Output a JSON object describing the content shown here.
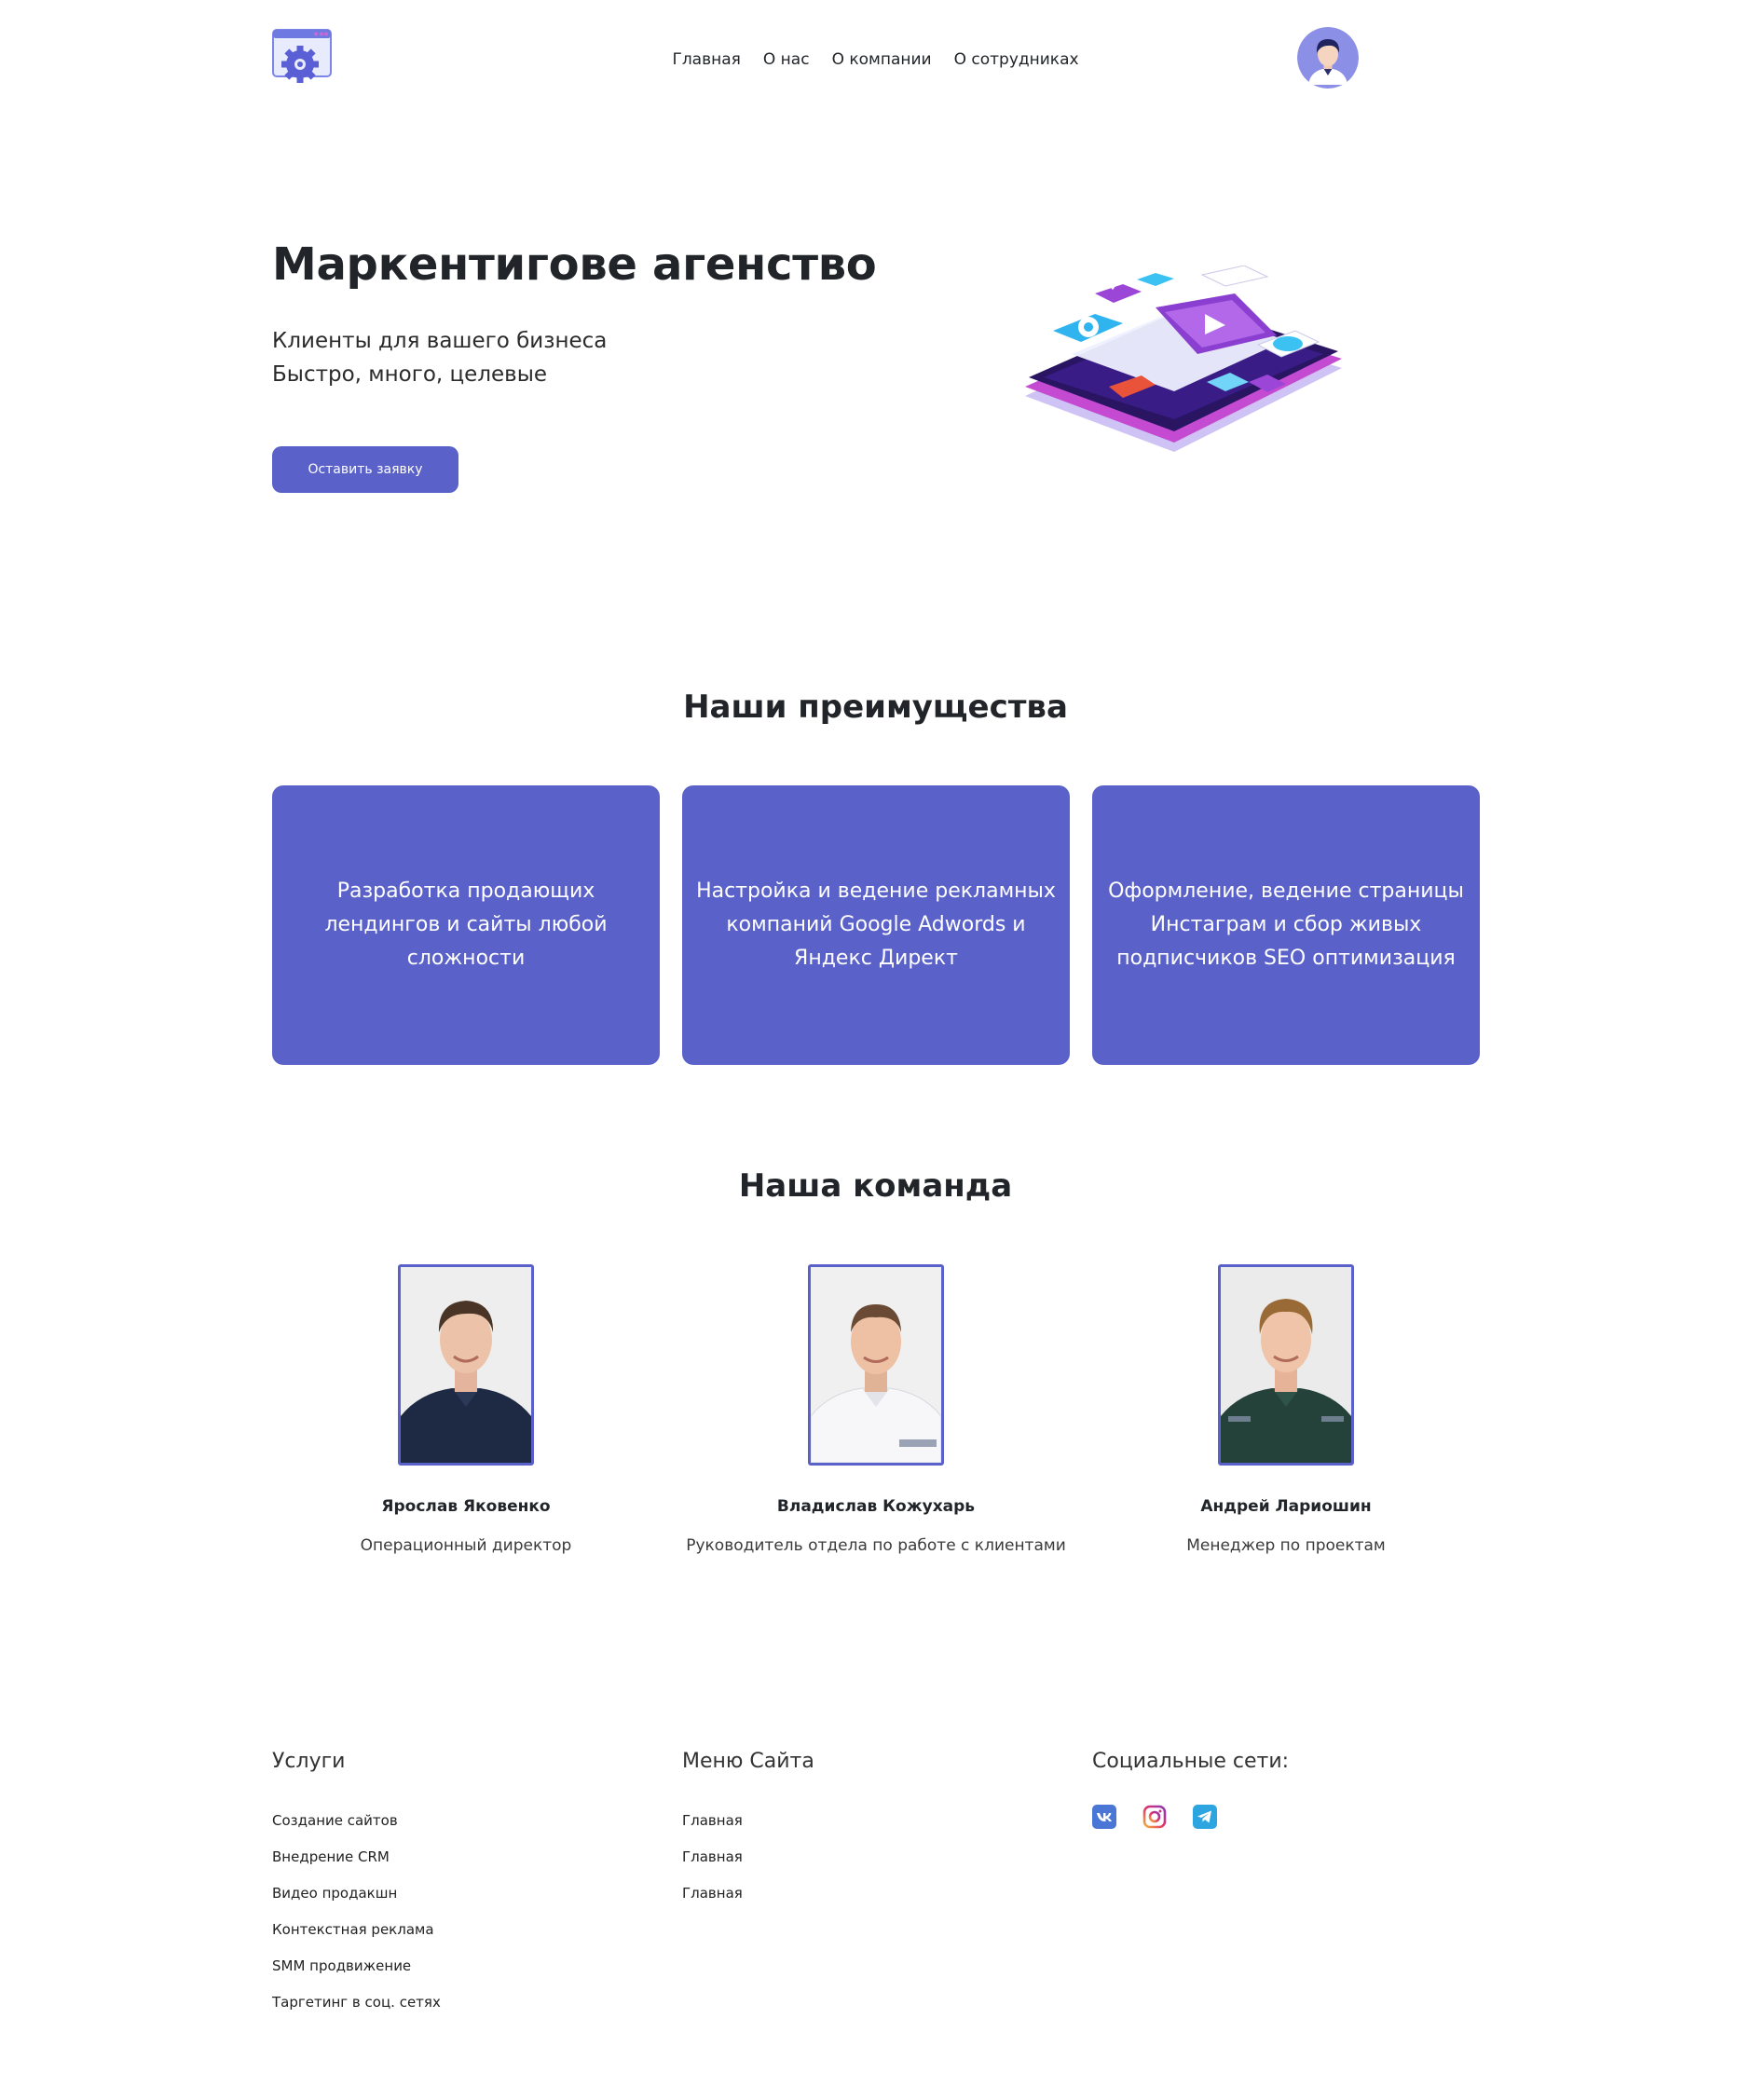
{
  "header": {
    "nav": [
      "Главная",
      "О нас",
      "О компании",
      "О сотрудниках"
    ]
  },
  "hero": {
    "title": "Маркентигове агенство",
    "subtitle_line1": "Клиенты для вашего бизнеса",
    "subtitle_line2": "Быстро, много, целевые",
    "button": "Оставить заявку"
  },
  "advantages": {
    "title": "Наши преимущества",
    "cards": [
      "Разработка продающих лендингов и сайты любой сложности",
      "Настройка и ведение рекламных компаний Google Adwords и Яндекс Директ",
      "Оформление, ведение страницы Инстаграм и сбор живых подписчиков SEO оптимизация"
    ]
  },
  "team": {
    "title": "Наша команда",
    "members": [
      {
        "name": "Ярослав Яковенко",
        "role": "Операционный директор"
      },
      {
        "name": "Владислав Кожухарь",
        "role": "Руководитель отдела по работе с клиентами"
      },
      {
        "name": "Андрей Лариошин",
        "role": "Менеджер по проектам"
      }
    ]
  },
  "footer": {
    "services_title": "Услуги",
    "services": [
      "Создание сайтов",
      "Внедрение CRM",
      "Видео продакшн",
      "Контекстная реклама",
      "SMM продвижение",
      "Таргетинг в соц. сетях"
    ],
    "menu_title": "Меню Сайта",
    "menu": [
      "Главная",
      "Главная",
      "Главная"
    ],
    "social_title": "Социальные сети:",
    "social_icons": [
      "vk-icon",
      "instagram-icon",
      "telegram-icon"
    ]
  },
  "colors": {
    "accent": "#5a61c9",
    "text": "#212529"
  }
}
